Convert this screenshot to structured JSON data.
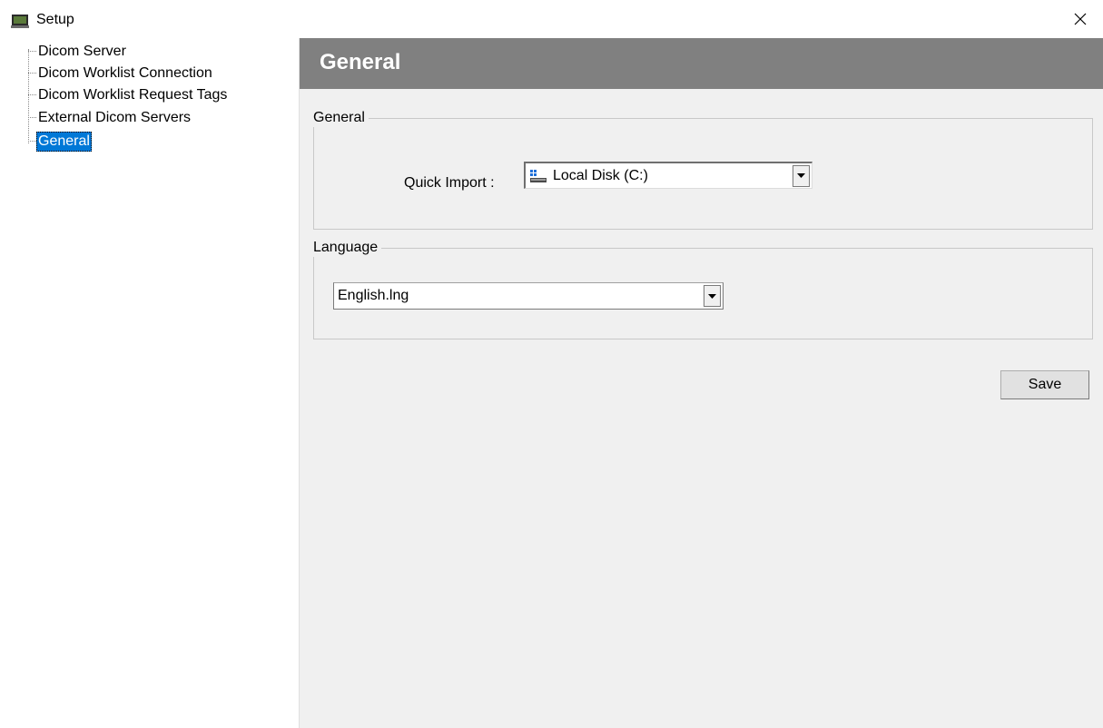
{
  "window": {
    "title": "Setup",
    "app_icon": "monitor-icon",
    "close_icon": "close-icon"
  },
  "tree": {
    "items": [
      {
        "label": "Dicom Server",
        "selected": false
      },
      {
        "label": "Dicom Worklist Connection",
        "selected": false
      },
      {
        "label": "Dicom Worklist Request Tags",
        "selected": false
      },
      {
        "label": "External Dicom Servers",
        "selected": false
      },
      {
        "label": "General",
        "selected": true
      }
    ]
  },
  "panel": {
    "title": "General",
    "header_color": "#808080",
    "general_group": {
      "legend": "General",
      "quick_import_label": "Quick Import :",
      "quick_import_value": "Local Disk (C:)",
      "quick_import_icon": "drive-icon"
    },
    "language_group": {
      "legend": "Language",
      "language_value": "English.lng"
    },
    "save_label": "Save"
  },
  "colors": {
    "selection": "#0078d7",
    "panel_bg": "#f0f0f0"
  }
}
